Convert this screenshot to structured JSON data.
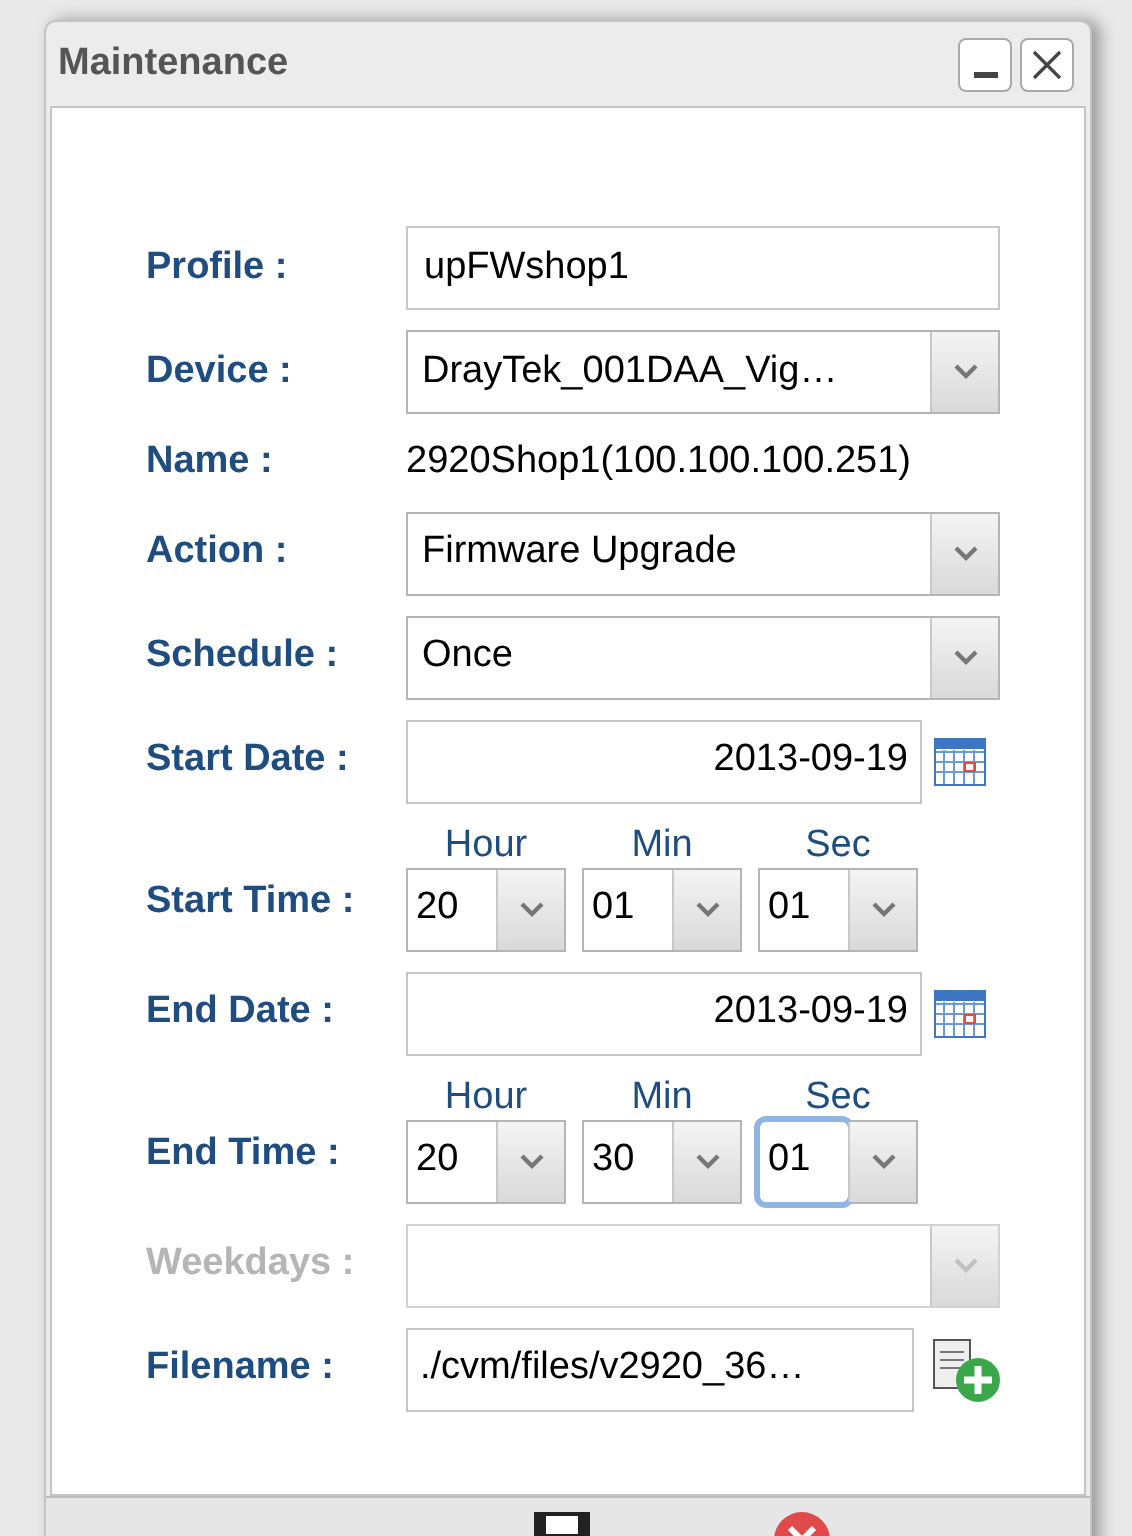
{
  "window": {
    "title": "Maintenance"
  },
  "rows": [
    {
      "kind": "text",
      "label": "Profile :",
      "value": "upFWshop1"
    },
    {
      "kind": "select",
      "label": "Device :",
      "value": "DrayTek_001DAA_Vig…",
      "disabled": false
    },
    {
      "kind": "static",
      "label": "Name :",
      "value": "2920Shop1(100.100.100.251)"
    },
    {
      "kind": "select",
      "label": "Action :",
      "value": "Firmware Upgrade",
      "disabled": false
    },
    {
      "kind": "select",
      "label": "Schedule :",
      "value": "Once",
      "disabled": false
    },
    {
      "kind": "date",
      "label": "Start Date :",
      "value": "2013-09-19"
    },
    {
      "kind": "time",
      "label": "Start Time :",
      "parts": [
        {
          "unit": "Hour",
          "value": "20",
          "focused": false
        },
        {
          "unit": "Min",
          "value": "01",
          "focused": false
        },
        {
          "unit": "Sec",
          "value": "01",
          "focused": false
        }
      ]
    },
    {
      "kind": "date",
      "label": "End Date :",
      "value": "2013-09-19"
    },
    {
      "kind": "time",
      "label": "End Time :",
      "parts": [
        {
          "unit": "Hour",
          "value": "20",
          "focused": false
        },
        {
          "unit": "Min",
          "value": "30",
          "focused": false
        },
        {
          "unit": "Sec",
          "value": "01",
          "focused": true
        }
      ]
    },
    {
      "kind": "select",
      "label": "Weekdays :",
      "value": "",
      "disabled": true
    },
    {
      "kind": "file",
      "label": "Filename :",
      "value": "./cvm/files/v2920_36…"
    }
  ]
}
